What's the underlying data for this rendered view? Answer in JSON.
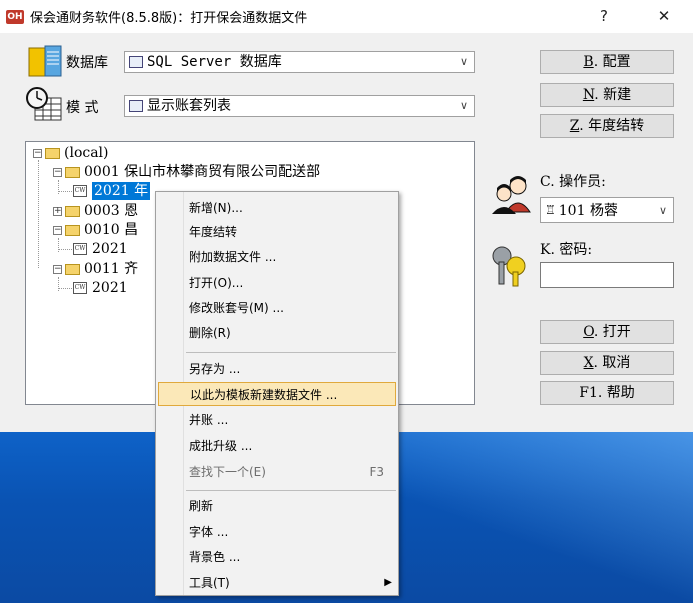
{
  "window": {
    "title": "保会通财务软件(8.5.8版)：打开保会通数据文件",
    "app_icon": "OH",
    "help": "?",
    "close": "✕"
  },
  "form": {
    "db_label": "数据库",
    "db_value": "SQL Server 数据库",
    "mode_label": "模  式",
    "mode_value": "显示账套列表",
    "operator_label": "C. 操作员:",
    "operator_value": "101 杨蓉",
    "password_label": "K. 密码:"
  },
  "buttons": {
    "config": {
      "key": "B",
      "text": ". 配置"
    },
    "new": {
      "key": "N",
      "text": ". 新建"
    },
    "yearend": {
      "key": "Z",
      "text": ". 年度结转"
    },
    "open": {
      "key": "O",
      "text": ". 打开"
    },
    "cancel": {
      "key": "X",
      "text": ". 取消"
    },
    "help": {
      "key": "",
      "text": "F1. 帮助"
    }
  },
  "tree": {
    "root": "(local)",
    "n1": "0001 保山市林攀商贸有限公司配送部",
    "n1_child": "2021 年",
    "n2": "0003 恩",
    "n3": "0010 昌",
    "n3_child": "2021",
    "n4": "0011 齐",
    "n4_child": "2021"
  },
  "menu": {
    "items": [
      {
        "label": "新增(N)..."
      },
      {
        "label": "年度结转"
      },
      {
        "label": "附加数据文件 ..."
      },
      {
        "label": "打开(O)..."
      },
      {
        "label": "修改账套号(M) ..."
      },
      {
        "label": "删除(R)"
      },
      {
        "label": "另存为 ..."
      },
      {
        "label": "以此为模板新建数据文件 ..."
      },
      {
        "label": "并账 ..."
      },
      {
        "label": "成批升级 ..."
      },
      {
        "label": "查找下一个(E)",
        "shortcut": "F3"
      },
      {
        "label": "刷新"
      },
      {
        "label": "字体 ..."
      },
      {
        "label": "背景色 ..."
      },
      {
        "label": "工具(T)",
        "submenu": "▶"
      }
    ]
  },
  "colors": {
    "selection": "#0078d7",
    "menu_highlight": "#fbe8b8",
    "desktop": "#0b5bc0"
  }
}
